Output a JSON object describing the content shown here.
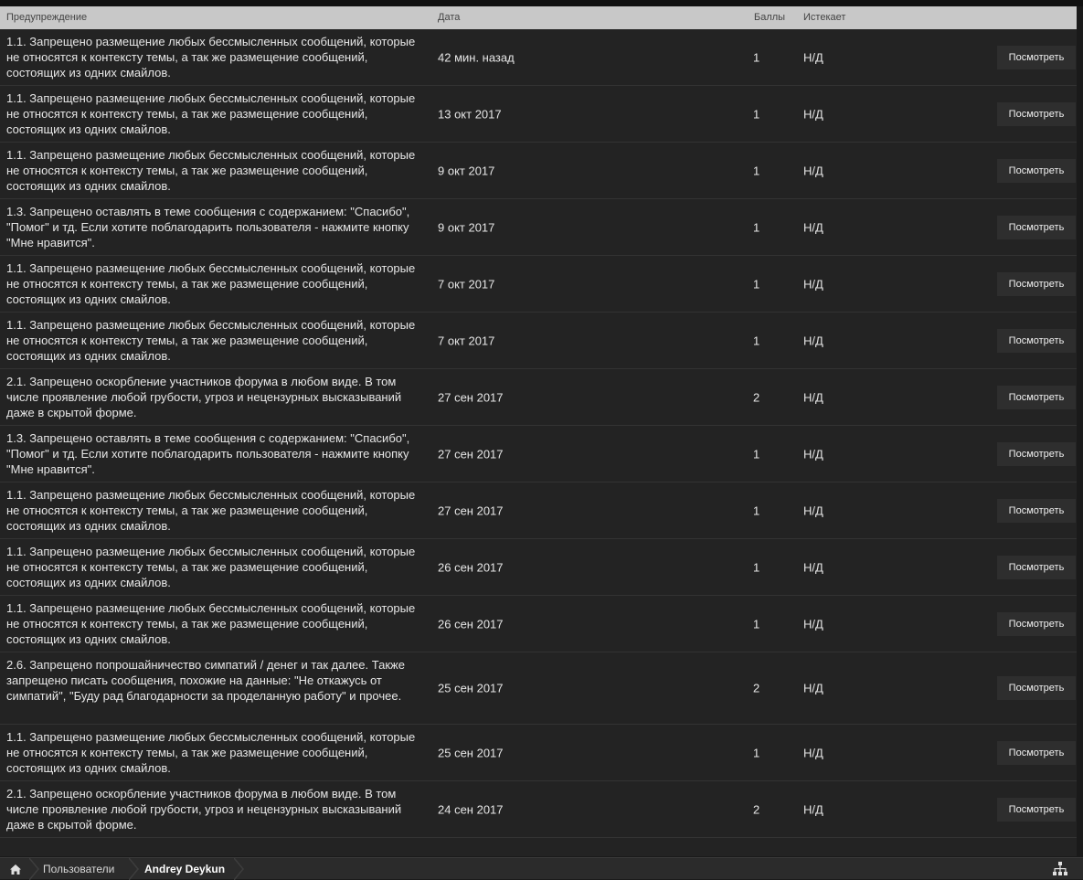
{
  "table": {
    "headers": {
      "warning": "Предупреждение",
      "date": "Дата",
      "points": "Баллы",
      "expires": "Истекает"
    },
    "rows": [
      {
        "warning": "1.1. Запрещено размещение любых бессмысленных сообщений, которые не относятся к контексту темы, а так же размещение сообщений, состоящих из одних смайлов.",
        "date": "42 мин. назад",
        "points": "1",
        "expires": "Н/Д",
        "action": "Посмотреть",
        "lines": 3
      },
      {
        "warning": "1.1. Запрещено размещение любых бессмысленных сообщений, которые не относятся к контексту темы, а так же размещение сообщений, состоящих из одних смайлов.",
        "date": "13 окт 2017",
        "points": "1",
        "expires": "Н/Д",
        "action": "Посмотреть",
        "lines": 3
      },
      {
        "warning": "1.1. Запрещено размещение любых бессмысленных сообщений, которые не относятся к контексту темы, а так же размещение сообщений, состоящих из одних смайлов.",
        "date": "9 окт 2017",
        "points": "1",
        "expires": "Н/Д",
        "action": "Посмотреть",
        "lines": 3
      },
      {
        "warning": "1.3. Запрещено оставлять в теме сообщения с содержанием: \"Спасибо\", \"Помог\" и тд. Если хотите поблагодарить пользователя - нажмите кнопку \"Мне нравится\".",
        "date": "9 окт 2017",
        "points": "1",
        "expires": "Н/Д",
        "action": "Посмотреть",
        "lines": 3
      },
      {
        "warning": "1.1. Запрещено размещение любых бессмысленных сообщений, которые не относятся к контексту темы, а так же размещение сообщений, состоящих из одних смайлов.",
        "date": "7 окт 2017",
        "points": "1",
        "expires": "Н/Д",
        "action": "Посмотреть",
        "lines": 3
      },
      {
        "warning": "1.1. Запрещено размещение любых бессмысленных сообщений, которые не относятся к контексту темы, а так же размещение сообщений, состоящих из одних смайлов.",
        "date": "7 окт 2017",
        "points": "1",
        "expires": "Н/Д",
        "action": "Посмотреть",
        "lines": 3
      },
      {
        "warning": "2.1. Запрещено оскорбление участников форума в любом виде. В том числе проявление любой грубости, угроз и нецензурных высказываний даже в скрытой форме.",
        "date": "27 сен 2017",
        "points": "2",
        "expires": "Н/Д",
        "action": "Посмотреть",
        "lines": 3
      },
      {
        "warning": "1.3. Запрещено оставлять в теме сообщения с содержанием: \"Спасибо\", \"Помог\" и тд. Если хотите поблагодарить пользователя - нажмите кнопку \"Мне нравится\".",
        "date": "27 сен 2017",
        "points": "1",
        "expires": "Н/Д",
        "action": "Посмотреть",
        "lines": 3
      },
      {
        "warning": "1.1. Запрещено размещение любых бессмысленных сообщений, которые не относятся к контексту темы, а так же размещение сообщений, состоящих из одних смайлов.",
        "date": "27 сен 2017",
        "points": "1",
        "expires": "Н/Д",
        "action": "Посмотреть",
        "lines": 3
      },
      {
        "warning": "1.1. Запрещено размещение любых бессмысленных сообщений, которые не относятся к контексту темы, а так же размещение сообщений, состоящих из одних смайлов.",
        "date": "26 сен 2017",
        "points": "1",
        "expires": "Н/Д",
        "action": "Посмотреть",
        "lines": 3
      },
      {
        "warning": "1.1. Запрещено размещение любых бессмысленных сообщений, которые не относятся к контексту темы, а так же размещение сообщений, состоящих из одних смайлов.",
        "date": "26 сен 2017",
        "points": "1",
        "expires": "Н/Д",
        "action": "Посмотреть",
        "lines": 3
      },
      {
        "warning": "2.6. Запрещено попрошайничество симпатий / денег и так далее. Также запрещено писать сообщения, похожие на данные: \"Не откажусь от симпатий\", \"Буду рад благодарности за проделанную работу\" и прочее.",
        "date": "25 сен 2017",
        "points": "2",
        "expires": "Н/Д",
        "action": "Посмотреть",
        "lines": 4
      },
      {
        "warning": "1.1. Запрещено размещение любых бессмысленных сообщений, которые не относятся к контексту темы, а так же размещение сообщений, состоящих из одних смайлов.",
        "date": "25 сен 2017",
        "points": "1",
        "expires": "Н/Д",
        "action": "Посмотреть",
        "lines": 3
      },
      {
        "warning": "2.1. Запрещено оскорбление участников форума в любом виде. В том числе проявление любой грубости, угроз и нецензурных высказываний даже в скрытой форме.",
        "date": "24 сен 2017",
        "points": "2",
        "expires": "Н/Д",
        "action": "Посмотреть",
        "lines": 3
      }
    ]
  },
  "breadcrumb": {
    "home_icon": "home-icon",
    "items": [
      "Пользователи",
      "Andrey Deykun"
    ],
    "sitemap_icon": "sitemap-icon"
  },
  "colors": {
    "header_bg": "#c8c8c8",
    "panel_bg": "#232323",
    "button_bg": "#2e2e2e"
  }
}
